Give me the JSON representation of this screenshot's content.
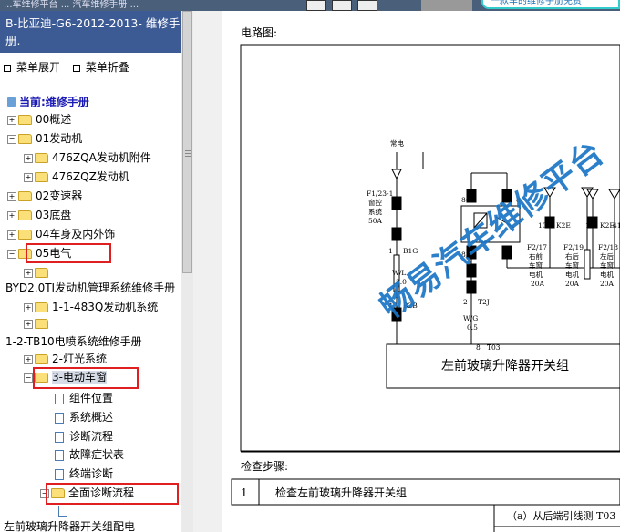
{
  "window": {
    "title": "...车维修平台 ... 汽车维修手册 ...",
    "banner_text": "一款车的维修手册免费"
  },
  "sidebar": {
    "header_title": "B-比亚迪-G6-2012-2013- 维修手册.",
    "menu_expand": "菜单展开",
    "menu_collapse": "菜单折叠",
    "current_label": "当前:维修手册",
    "tree": {
      "n00": "00概述",
      "n01": "01发动机",
      "n01a": "476ZQA发动机附件",
      "n01b": "476ZQZ发动机",
      "n02": "02变速器",
      "n03": "03底盘",
      "n04": "04车身及内外饰",
      "n05": "05电气",
      "byd": "BYD2.0TI发动机管理系统维修手册",
      "ems": "1-1-483Q发动机系统",
      "tb10": "1-2-TB10电喷系统维修手册",
      "light": "2-灯光系统",
      "window": "3-电动车窗",
      "c1": "组件位置",
      "c2": "系统概述",
      "c3": "诊断流程",
      "c4": "故障症状表",
      "c5": "终端诊断",
      "c6": "全面诊断流程",
      "bottom": "左前玻璃升降器开关组配电"
    }
  },
  "content": {
    "diagram_title": "电路图:",
    "diagram": {
      "fuse_label_1": "常电",
      "fuse_label_2": "F1/23-1",
      "fuse_label_3": "窗控",
      "fuse_label_4": "系统",
      "fuse_label_5": "50A",
      "conn_b1g": "B1G",
      "wire_w": "W/L",
      "wire_w_size": "3.0",
      "conn_b2b": "B2B",
      "conn_t2j": "T2J",
      "wire_wg": "W/G",
      "wire_wg_size": "0.5",
      "conn_t03": "T03",
      "relay_86": "86",
      "relay_85": "85",
      "pin1": "1",
      "pin4": "4",
      "pin2": "2",
      "pin8": "8",
      "pin10": "10",
      "k2e_1": "K2E",
      "k2e_2": "K2E",
      "pin41": "41",
      "pin11": "11",
      "f2_17": "F2/17",
      "f2_19": "F2/19",
      "f2_18": "F2/18",
      "right_front": "右前",
      "rear_left": "右后",
      "window_motor": "车窗",
      "motor": "电机",
      "amp20": "20A",
      "amp20b": "20A",
      "amp20c": "20A",
      "rl_1": "左后",
      "rl_2": "车窗",
      "rl_3": "电机",
      "fr_2": "车窗",
      "fr_3": "电机",
      "switch_group": "左前玻璃升降器开关组"
    },
    "check_steps_label": "检查步骤:",
    "step_no": "1",
    "step_text": "检查左前玻璃升降器开关组",
    "sub_caption": "（a）从后端引线测 T03"
  },
  "watermark": "畅易汽车维修平台"
}
